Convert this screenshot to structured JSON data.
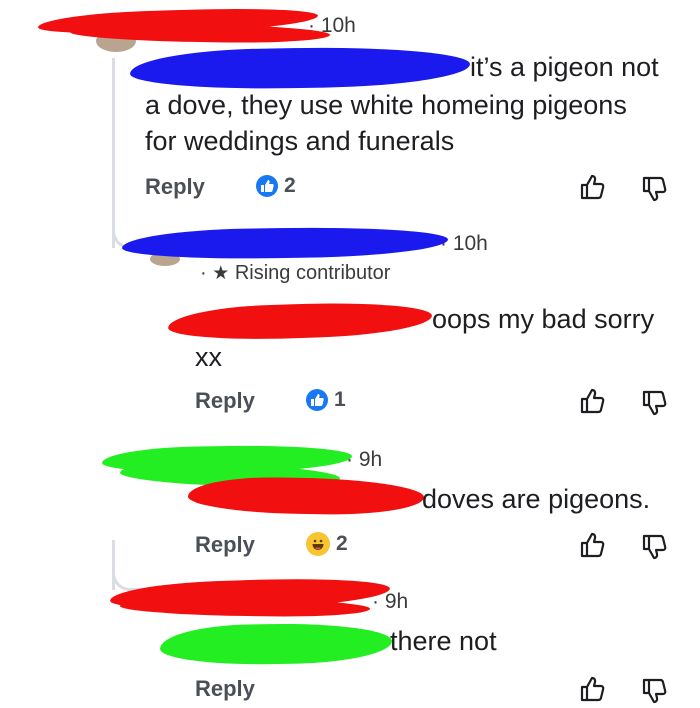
{
  "comments": [
    {
      "time": "10h",
      "text_line1": "it’s a pigeon not",
      "text_line2": "a dove, they use white homeing pigeons",
      "text_line3": "for weddings and funerals",
      "reply_label": "Reply",
      "reaction_count": "2",
      "reaction_type": "like-icon"
    },
    {
      "time": "10h",
      "badge_separator": "·",
      "badge": "Rising contributor",
      "text_line1": "oops my bad sorry",
      "text_line2": "xx",
      "reply_label": "Reply",
      "reaction_count": "1",
      "reaction_type": "like-icon"
    },
    {
      "time": "9h",
      "text_line1": "doves are pigeons.",
      "reply_label": "Reply",
      "reaction_count": "2",
      "reaction_type": "haha-icon"
    },
    {
      "time": "9h",
      "text_line1": "there not",
      "reply_label": "Reply"
    }
  ],
  "colors": {
    "like_blue": "#1877f2",
    "haha_yellow": "#f7c531",
    "redaction_red": "#f20f0f",
    "redaction_blue": "#1a1aee",
    "redaction_green": "#22ee22"
  }
}
